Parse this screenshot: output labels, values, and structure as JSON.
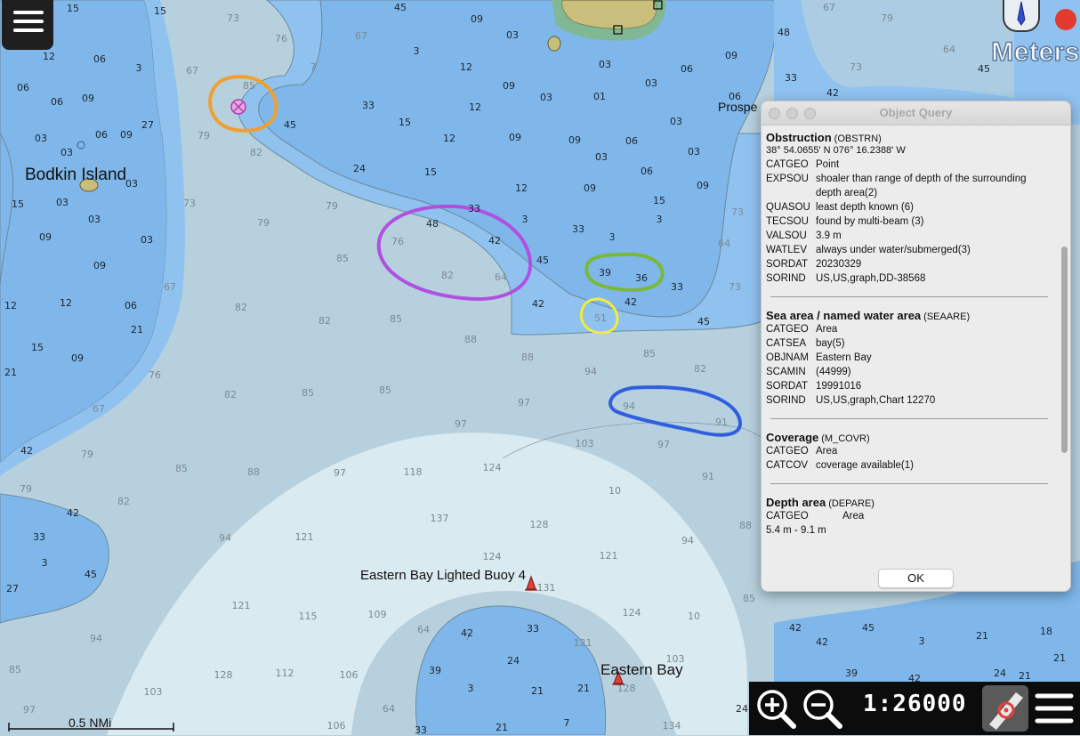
{
  "map": {
    "places": {
      "bodkin_island": "Bodkin Island",
      "prospect": "Prospe",
      "buoy_label": "Eastern Bay Lighted Buoy 4",
      "eastern_bay": "Eastern Bay"
    },
    "units_label": "Meters",
    "scale_bar_label": "0.5 NMi",
    "soundings": [
      [
        "15",
        82,
        9,
        "s"
      ],
      [
        "15",
        180,
        12,
        "s"
      ],
      [
        "12",
        55,
        63,
        "s"
      ],
      [
        "06",
        112,
        66,
        "s"
      ],
      [
        "3",
        156,
        76,
        "s"
      ],
      [
        "06",
        26,
        98,
        "s"
      ],
      [
        "09",
        99,
        110,
        "s"
      ],
      [
        "06",
        64,
        114,
        "s"
      ],
      [
        "27",
        166,
        140,
        "s"
      ],
      [
        "06",
        114,
        151,
        "s"
      ],
      [
        "03",
        46,
        155,
        "s"
      ],
      [
        "09",
        142,
        151,
        "s"
      ],
      [
        "03",
        75,
        171,
        "s"
      ],
      [
        "03",
        148,
        206,
        "s"
      ],
      [
        "15",
        20,
        229,
        "s"
      ],
      [
        "03",
        70,
        227,
        "s"
      ],
      [
        "03",
        106,
        246,
        "s"
      ],
      [
        "09",
        51,
        266,
        "s"
      ],
      [
        "03",
        165,
        269,
        "s"
      ],
      [
        "09",
        112,
        298,
        "s"
      ],
      [
        "12",
        12,
        343,
        "s"
      ],
      [
        "12",
        74,
        340,
        "s"
      ],
      [
        "06",
        147,
        343,
        "s"
      ],
      [
        "21",
        154,
        370,
        "s"
      ],
      [
        "15",
        42,
        390,
        "s"
      ],
      [
        "09",
        87,
        402,
        "s"
      ],
      [
        "21",
        12,
        418,
        "s"
      ],
      [
        "73",
        262,
        20,
        "d"
      ],
      [
        "76",
        316,
        43,
        "d"
      ],
      [
        "67",
        406,
        40,
        "d"
      ],
      [
        "7",
        352,
        75,
        "d"
      ],
      [
        "67",
        216,
        79,
        "d"
      ],
      [
        "85",
        280,
        96,
        "d"
      ],
      [
        "79",
        229,
        152,
        "d"
      ],
      [
        "82",
        288,
        171,
        "d"
      ],
      [
        "73",
        213,
        228,
        "d"
      ],
      [
        "79",
        373,
        231,
        "d"
      ],
      [
        "79",
        296,
        250,
        "d"
      ],
      [
        "85",
        385,
        290,
        "d"
      ],
      [
        "67",
        191,
        322,
        "d"
      ],
      [
        "82",
        271,
        345,
        "d"
      ],
      [
        "82",
        365,
        360,
        "d"
      ],
      [
        "85",
        445,
        358,
        "d"
      ],
      [
        "88",
        529,
        381,
        "d"
      ],
      [
        "88",
        593,
        401,
        "d"
      ],
      [
        "76",
        174,
        421,
        "d"
      ],
      [
        "82",
        259,
        443,
        "d"
      ],
      [
        "85",
        346,
        441,
        "d"
      ],
      [
        "85",
        433,
        438,
        "d"
      ],
      [
        "67",
        111,
        459,
        "d"
      ],
      [
        "97",
        589,
        452,
        "d"
      ],
      [
        "97",
        518,
        476,
        "d"
      ],
      [
        "79",
        98,
        510,
        "d"
      ],
      [
        "85",
        204,
        526,
        "d"
      ],
      [
        "88",
        285,
        530,
        "d"
      ],
      [
        "97",
        382,
        531,
        "d"
      ],
      [
        "118",
        464,
        530,
        "d"
      ],
      [
        "103",
        657,
        498,
        "d"
      ],
      [
        "97",
        746,
        499,
        "d"
      ],
      [
        "124",
        553,
        525,
        "d"
      ],
      [
        "10",
        691,
        551,
        "d"
      ],
      [
        "91",
        796,
        535,
        "d"
      ],
      [
        "79",
        29,
        549,
        "d"
      ],
      [
        "82",
        139,
        563,
        "d"
      ],
      [
        "94",
        253,
        604,
        "d"
      ],
      [
        "121",
        342,
        603,
        "d"
      ],
      [
        "137",
        494,
        582,
        "d"
      ],
      [
        "128",
        606,
        589,
        "d"
      ],
      [
        "94",
        773,
        607,
        "d"
      ],
      [
        "121",
        684,
        624,
        "d"
      ],
      [
        "124",
        553,
        625,
        "d"
      ],
      [
        "131",
        614,
        660,
        "d"
      ],
      [
        "121",
        271,
        680,
        "d"
      ],
      [
        "115",
        346,
        692,
        "d"
      ],
      [
        "109",
        424,
        690,
        "d"
      ],
      [
        "124",
        710,
        688,
        "d"
      ],
      [
        "10",
        780,
        692,
        "d"
      ],
      [
        "94",
        108,
        717,
        "d"
      ],
      [
        "112",
        320,
        756,
        "d"
      ],
      [
        "106",
        392,
        758,
        "d"
      ],
      [
        "128",
        251,
        758,
        "d"
      ],
      [
        "103",
        172,
        777,
        "d"
      ],
      [
        "85",
        17,
        752,
        "d"
      ],
      [
        "97",
        33,
        797,
        "d"
      ],
      [
        "106",
        378,
        815,
        "d"
      ],
      [
        "134",
        755,
        815,
        "d"
      ],
      [
        "64",
        437,
        796,
        "d"
      ],
      [
        "64",
        476,
        707,
        "d"
      ],
      [
        "7",
        526,
        715,
        "d"
      ],
      [
        "121",
        655,
        722,
        "d"
      ],
      [
        "103",
        759,
        740,
        "d"
      ],
      [
        "128",
        704,
        773,
        "d"
      ],
      [
        "94",
        664,
        417,
        "d"
      ],
      [
        "85",
        730,
        397,
        "d"
      ],
      [
        "82",
        787,
        414,
        "d"
      ],
      [
        "94",
        707,
        456,
        "d"
      ],
      [
        "91",
        811,
        474,
        "d"
      ],
      [
        "76",
        447,
        271,
        "d"
      ],
      [
        "82",
        503,
        309,
        "d"
      ],
      [
        "64",
        563,
        311,
        "d"
      ],
      [
        "51",
        675,
        357,
        "d"
      ],
      [
        "64",
        814,
        273,
        "d"
      ],
      [
        "73",
        826,
        322,
        "d"
      ],
      [
        "88",
        838,
        590,
        "d"
      ],
      [
        "85",
        842,
        672,
        "d"
      ],
      [
        "67",
        932,
        8,
        "d"
      ],
      [
        "79",
        997,
        20,
        "d"
      ],
      [
        "73",
        962,
        75,
        "d"
      ],
      [
        "64",
        1067,
        55,
        "d"
      ],
      [
        "73",
        829,
        238,
        "d"
      ],
      [
        "45",
        450,
        8,
        "s"
      ],
      [
        "09",
        536,
        21,
        "s"
      ],
      [
        "03",
        576,
        39,
        "s"
      ],
      [
        "3",
        468,
        57,
        "s"
      ],
      [
        "12",
        524,
        75,
        "s"
      ],
      [
        "03",
        680,
        72,
        "s"
      ],
      [
        "06",
        772,
        77,
        "s"
      ],
      [
        "09",
        822,
        62,
        "s"
      ],
      [
        "09",
        572,
        96,
        "s"
      ],
      [
        "03",
        614,
        109,
        "s"
      ],
      [
        "01",
        674,
        108,
        "s"
      ],
      [
        "03",
        732,
        93,
        "s"
      ],
      [
        "06",
        826,
        108,
        "s"
      ],
      [
        "33",
        414,
        118,
        "s"
      ],
      [
        "12",
        534,
        120,
        "s"
      ],
      [
        "03",
        760,
        136,
        "s"
      ],
      [
        "45",
        326,
        140,
        "s"
      ],
      [
        "15",
        455,
        137,
        "s"
      ],
      [
        "12",
        505,
        155,
        "s"
      ],
      [
        "09",
        579,
        154,
        "s"
      ],
      [
        "09",
        646,
        157,
        "s"
      ],
      [
        "06",
        710,
        158,
        "s"
      ],
      [
        "03",
        676,
        176,
        "s"
      ],
      [
        "06",
        727,
        192,
        "s"
      ],
      [
        "03",
        780,
        170,
        "s"
      ],
      [
        "24",
        404,
        189,
        "s"
      ],
      [
        "15",
        484,
        193,
        "s"
      ],
      [
        "12",
        586,
        211,
        "s"
      ],
      [
        "09",
        663,
        211,
        "s"
      ],
      [
        "09",
        790,
        208,
        "s"
      ],
      [
        "15",
        741,
        225,
        "s"
      ],
      [
        "33",
        533,
        234,
        "s"
      ],
      [
        "3",
        590,
        246,
        "s"
      ],
      [
        "33",
        650,
        257,
        "s"
      ],
      [
        "3",
        741,
        246,
        "s"
      ],
      [
        "48",
        486,
        251,
        "s"
      ],
      [
        "42",
        556,
        270,
        "s"
      ],
      [
        "3",
        688,
        266,
        "s"
      ],
      [
        "45",
        610,
        292,
        "s"
      ],
      [
        "39",
        680,
        306,
        "s"
      ],
      [
        "36",
        721,
        312,
        "s"
      ],
      [
        "33",
        761,
        322,
        "s"
      ],
      [
        "42",
        605,
        341,
        "s"
      ],
      [
        "42",
        709,
        339,
        "s"
      ],
      [
        "45",
        791,
        361,
        "s"
      ],
      [
        "45",
        1106,
        77,
        "s"
      ],
      [
        "48",
        881,
        36,
        "s"
      ],
      [
        "33",
        889,
        87,
        "s"
      ],
      [
        "42",
        936,
        104,
        "s"
      ],
      [
        "24",
        834,
        796,
        "s"
      ],
      [
        "42",
        30,
        506,
        "s"
      ],
      [
        "42",
        82,
        576,
        "s"
      ],
      [
        "33",
        44,
        603,
        "s"
      ],
      [
        "3",
        50,
        632,
        "s"
      ],
      [
        "45",
        102,
        645,
        "s"
      ],
      [
        "27",
        14,
        661,
        "s"
      ],
      [
        "42",
        525,
        711,
        "s"
      ],
      [
        "33",
        599,
        706,
        "s"
      ],
      [
        "24",
        577,
        742,
        "s"
      ],
      [
        "39",
        489,
        753,
        "s"
      ],
      [
        "3",
        529,
        773,
        "s"
      ],
      [
        "21",
        604,
        776,
        "s"
      ],
      [
        "21",
        656,
        773,
        "s"
      ],
      [
        "21",
        564,
        817,
        "s"
      ],
      [
        "33",
        473,
        820,
        "s"
      ],
      [
        "42",
        924,
        721,
        "s"
      ],
      [
        "45",
        976,
        705,
        "s"
      ],
      [
        "3",
        1036,
        720,
        "s"
      ],
      [
        "21",
        1104,
        714,
        "s"
      ],
      [
        "18",
        1176,
        709,
        "s"
      ],
      [
        "21",
        1191,
        739,
        "s"
      ],
      [
        "39",
        957,
        756,
        "s"
      ],
      [
        "42",
        1028,
        762,
        "s"
      ],
      [
        "24",
        1124,
        756,
        "s"
      ],
      [
        "21",
        1152,
        759,
        "s"
      ],
      [
        "42",
        894,
        705,
        "s"
      ],
      [
        "7",
        637,
        812,
        "s"
      ]
    ]
  },
  "dialog": {
    "title": "Object Query",
    "sections": [
      {
        "title": "Obstruction",
        "code": "(OBSTRN)",
        "coord": "38° 54.0655' N 076° 16.2388' W",
        "rows": [
          [
            "CATGEO",
            "Point"
          ],
          [
            "EXPSOU",
            "shoaler than range of depth of the surrounding depth area(2)"
          ],
          [
            "QUASOU",
            "least depth known (6)"
          ],
          [
            "TECSOU",
            "found by multi-beam (3)"
          ],
          [
            "VALSOU",
            "3.9 m"
          ],
          [
            "WATLEV",
            "always under water/submerged(3)"
          ],
          [
            "SORDAT",
            "20230329"
          ],
          [
            "SORIND",
            "US,US,graph,DD-38568"
          ]
        ]
      },
      {
        "title": "Sea area / named water area",
        "code": "(SEAARE)",
        "rows": [
          [
            "CATGEO",
            "Area"
          ],
          [
            "CATSEA",
            "bay(5)"
          ],
          [
            "OBJNAM",
            "Eastern Bay"
          ],
          [
            "SCAMIN",
            "(44999)"
          ],
          [
            "SORDAT",
            "19991016"
          ],
          [
            "SORIND",
            "US,US,graph,Chart 12270"
          ]
        ]
      },
      {
        "title": "Coverage",
        "code": "(M_COVR)",
        "rows": [
          [
            "CATGEO",
            "Area"
          ],
          [
            "CATCOV",
            "coverage available(1)"
          ]
        ]
      },
      {
        "title": "Depth area",
        "code": "(DEPARE)",
        "rows": [
          [
            "CATGEO",
            "Area"
          ],
          [
            "",
            "5.4 m - 9.1 m"
          ]
        ]
      }
    ],
    "ok_label": "OK"
  },
  "toolbar": {
    "scale": "1:26000",
    "icons": [
      "zoom-in-icon",
      "zoom-out-icon",
      "route-icon",
      "list-menu-icon"
    ]
  },
  "colors": {
    "deep_water": "#b7d0dd",
    "very_deep_water": "#d9eaf0",
    "shallow_water": "#7fb7ea",
    "medium_water": "#8fc2ef",
    "land": "#c9be7b",
    "annotation_orange": "#f0a030",
    "annotation_purple": "#b050e0",
    "annotation_green": "#7ab83c",
    "annotation_yellow": "#f2ec3a",
    "annotation_blue": "#2f5fe0"
  }
}
